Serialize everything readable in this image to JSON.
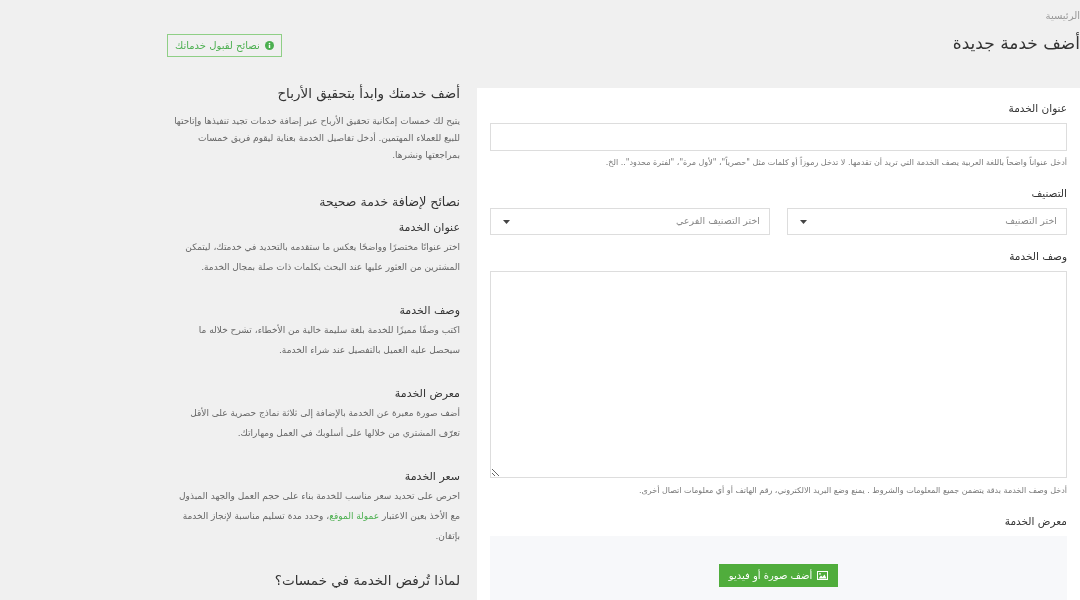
{
  "breadcrumb": [
    {
      "label": "الرئيسية"
    }
  ],
  "page_title": "أضف خدمة جديدة",
  "tips_button": {
    "label": "نصائح لقبول خدماتك"
  },
  "form": {
    "title_field": {
      "label": "عنوان الخدمة",
      "hint": "أدخل عنواناً واضحاً باللغة العربية يصف الخدمة التي تريد أن تقدمها. لا تدخل رموزاً أو كلمات مثل \"حصرياً\"، \"لأول مرة\"، \"لفترة محدود\".. الخ."
    },
    "category": {
      "label": "التصنيف",
      "selects": [
        {
          "placeholder": "اختر التصنيف"
        },
        {
          "placeholder": "اختر التصنيف الفرعي"
        }
      ]
    },
    "description_field": {
      "label": "وصف الخدمة",
      "hint": "أدخل وصف الخدمة بدقة يتضمن جميع المعلومات والشروط . يمنع وضع البريد الالكتروني، رقم الهاتف أو أي معلومات اتصال أخرى."
    },
    "gallery": {
      "label": "معرض الخدمة",
      "button": "أضف صورة أو فيديو"
    }
  },
  "sidebar": {
    "intro": {
      "heading": "أضف خدمتك وابدأ بتحقيق الأرباح",
      "text": "يتيح لك خمسات إمكانية تحقيق الأرباح عبر إضافة خدمات تجيد تنفيذها وإتاحتها للبيع للعملاء المهتمين. أدخل تفاصيل الخدمة بعناية ليقوم فريق خمسات بمراجعتها ونشرها."
    },
    "tips": {
      "heading": "نصائح لإضافة خدمة صحيحة",
      "items": [
        {
          "title": "عنوان الخدمة",
          "text": "اختر عنوانًا مختصرًا وواضحًا يعكس ما ستقدمه بالتحديد في خدمتك، ليتمكن المشترين من العثور عليها عند البحث بكلمات ذات صلة بمجال الخدمة."
        },
        {
          "title": "وصف الخدمة",
          "text": "اكتب وصفًا مميزًا للخدمة بلغة سليمة خالية من الأخطاء، تشرح خلاله ما سيحصل عليه العميل بالتفصيل عند شراء الخدمة."
        },
        {
          "title": "معرض الخدمة",
          "text": "أضف صورة معبرة عن الخدمة بالإضافة إلى ثلاثة نماذج حصرية على الأقل تعرّف المشتري من خلالها على أسلوبك في العمل ومهاراتك."
        },
        {
          "title": "سعر الخدمة",
          "text": "احرص على تحديد سعر مناسب للخدمة بناء على حجم العمل والجهد المبذول مع الأخذ بعين الاعتبار",
          "link": "عمولة الموقع",
          "text_after": "، وحدد مدة تسليم مناسبة لإنجاز الخدمة بإتقان."
        }
      ]
    },
    "rejection": {
      "heading": "لماذا تُرفض الخدمة في خمسات؟"
    }
  }
}
